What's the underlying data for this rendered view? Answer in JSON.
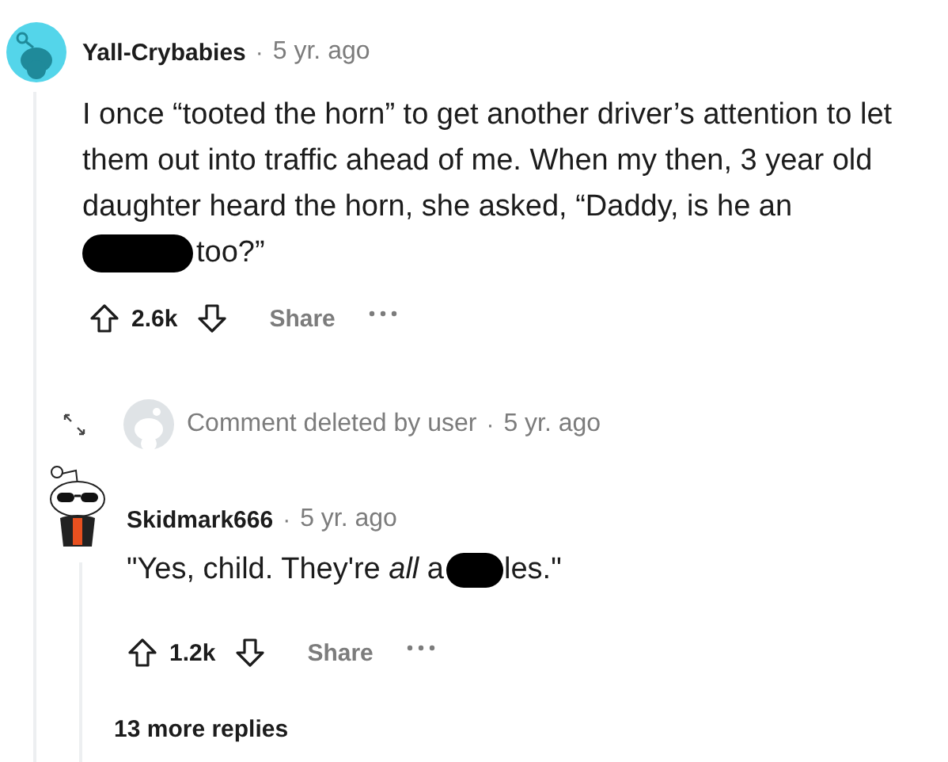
{
  "thread": [
    {
      "kind": "comment",
      "author": "Yall-Crybabies",
      "separator": "·",
      "age": "5 yr. ago",
      "body": [
        {
          "kind": "text",
          "text": "I once “tooted the horn” to get another driver’s attention to let them out into traffic ahead of me. When my then, 3 year old daughter heard the horn, she asked, “Daddy, is he an"
        },
        {
          "kind": "redacted"
        },
        {
          "kind": "text",
          "text": "too?”"
        }
      ],
      "score": "2.6k",
      "share": "Share"
    },
    {
      "kind": "deleted",
      "text": "Comment deleted by user",
      "separator": "·",
      "age": "5 yr. ago"
    },
    {
      "kind": "comment",
      "author": "Skidmark666",
      "separator": "·",
      "age": "5 yr. ago",
      "body": [
        {
          "kind": "text",
          "text": "\"Yes, child. They're *all* a"
        },
        {
          "kind": "redacted"
        },
        {
          "kind": "text",
          "text": "les.\""
        }
      ],
      "score": "1.2k",
      "share": "Share"
    }
  ],
  "more_replies": "13 more replies"
}
